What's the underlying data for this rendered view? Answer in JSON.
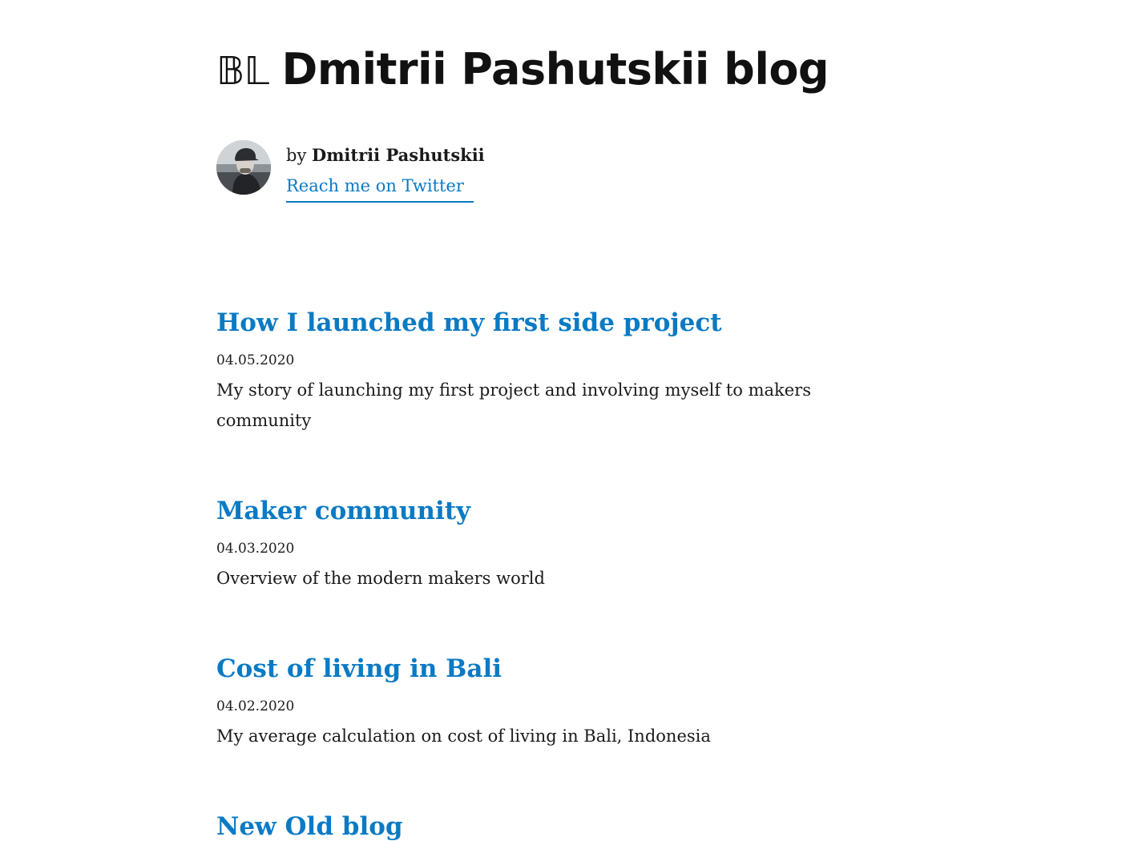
{
  "header": {
    "title_prefix": "𝔹𝕃",
    "title": "Dmitrii Pashutskii blog"
  },
  "author": {
    "by_label": "by",
    "name": "Dmitrii Pashutskii",
    "twitter_label": "Reach me on Twitter",
    "avatar_icon": "avatar-photo"
  },
  "posts": [
    {
      "title": "How I launched my first side project",
      "date": "04.05.2020",
      "excerpt": "My story of launching my first project and involving myself to makers community"
    },
    {
      "title": "Maker community",
      "date": "04.03.2020",
      "excerpt": "Overview of the modern makers world"
    },
    {
      "title": "Cost of living in Bali",
      "date": "04.02.2020",
      "excerpt": "My average calculation on cost of living in Bali, Indonesia"
    },
    {
      "title": "New Old blog",
      "date": "",
      "excerpt": ""
    }
  ],
  "colors": {
    "accent": "#0a7ac4",
    "text": "#1a1a1a",
    "background": "#ffffff"
  }
}
